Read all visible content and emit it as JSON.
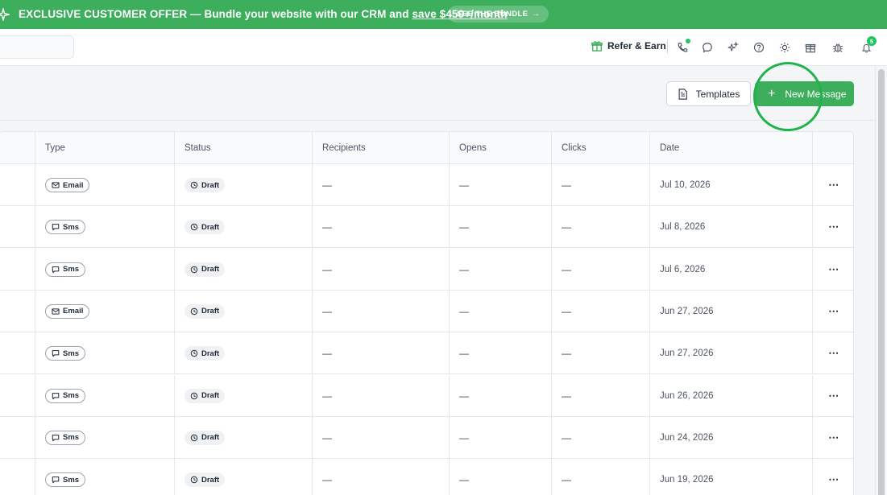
{
  "banner": {
    "text_prefix": "EXCLUSIVE CUSTOMER OFFER — Bundle your website with our CRM and ",
    "text_highlight": "save $450+/month",
    "button_label": "SEE THE BUNDLE",
    "color": "#3cae5c"
  },
  "topbar": {
    "refer_label": "Refer & Earn",
    "notification_count": "5",
    "icons": [
      "gift-icon",
      "phone-icon",
      "chat-icon",
      "sparkle-icon",
      "help-icon",
      "sun-icon",
      "gift-box-icon",
      "bug-icon",
      "bell-icon"
    ]
  },
  "toolbar": {
    "templates_label": "Templates",
    "new_message_label": "New Message"
  },
  "table": {
    "columns": [
      "Type",
      "Status",
      "Recipients",
      "Opens",
      "Clicks",
      "Date"
    ],
    "rows": [
      {
        "type": "Email",
        "status": "Draft",
        "recipients": "—",
        "opens": "—",
        "clicks": "—",
        "date": "Jul 10, 2026"
      },
      {
        "type": "Sms",
        "status": "Draft",
        "recipients": "—",
        "opens": "—",
        "clicks": "—",
        "date": "Jul 8, 2026"
      },
      {
        "type": "Sms",
        "status": "Draft",
        "recipients": "—",
        "opens": "—",
        "clicks": "—",
        "date": "Jul 6, 2026"
      },
      {
        "type": "Email",
        "status": "Draft",
        "recipients": "—",
        "opens": "—",
        "clicks": "—",
        "date": "Jun 27, 2026"
      },
      {
        "type": "Sms",
        "status": "Draft",
        "recipients": "—",
        "opens": "—",
        "clicks": "—",
        "date": "Jun 27, 2026"
      },
      {
        "type": "Sms",
        "status": "Draft",
        "recipients": "—",
        "opens": "—",
        "clicks": "—",
        "date": "Jun 26, 2026"
      },
      {
        "type": "Sms",
        "status": "Draft",
        "recipients": "—",
        "opens": "—",
        "clicks": "—",
        "date": "Jun 24, 2026"
      },
      {
        "type": "Sms",
        "status": "Draft",
        "recipients": "—",
        "opens": "—",
        "clicks": "—",
        "date": "Jun 19, 2026"
      }
    ],
    "row_action": "⋯"
  },
  "colors": {
    "accent": "#3cae5c",
    "badge": "#22c55e"
  }
}
